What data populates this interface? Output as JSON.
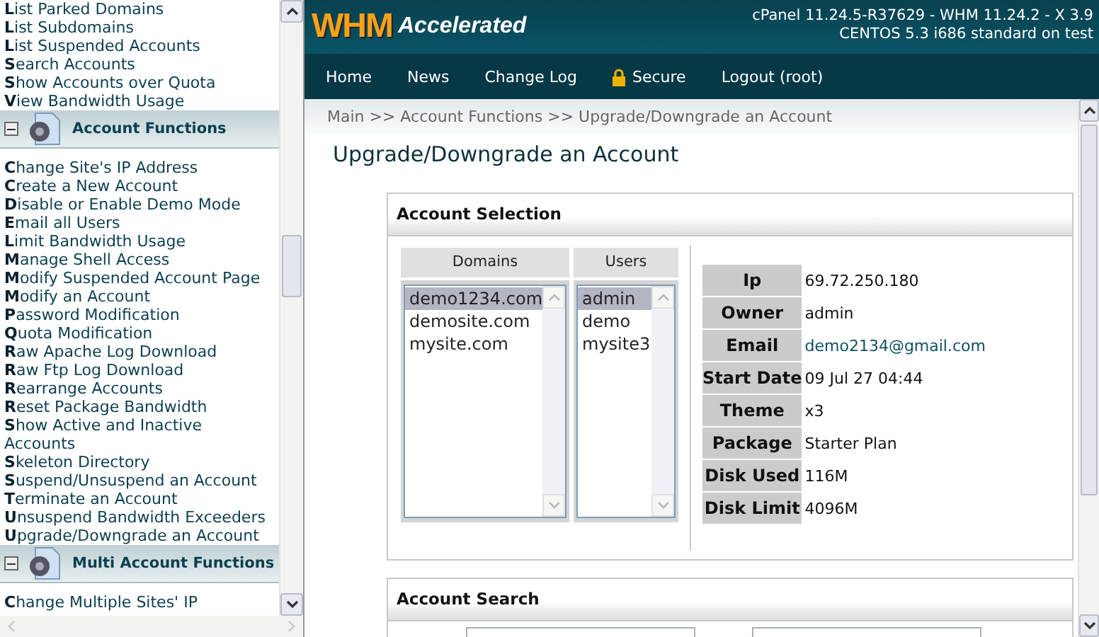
{
  "sidebar": {
    "top_links": [
      "**L**ist Parked Domains",
      "**L**ist Subdomains",
      "**L**ist Suspended Accounts",
      "**S**earch Accounts",
      "**S**how Accounts over Quota",
      "**V**iew Bandwidth Usage"
    ],
    "sections": [
      {
        "title": "Account Functions",
        "expanded": true,
        "links": [
          "**C**hange Site's IP Address",
          "**C**reate a New Account",
          "**D**isable or Enable Demo Mode",
          "**E**mail all Users",
          "**L**imit Bandwidth Usage",
          "**M**anage Shell Access",
          "**M**odify Suspended Account Page",
          "**M**odify an Account",
          "**P**assword Modification",
          "**Q**uota Modification",
          "**R**aw Apache Log Download",
          "**R**aw Ftp Log Download",
          "**R**earrange Accounts",
          "**R**eset Package Bandwidth",
          "**S**how Active and Inactive Accounts",
          "**S**keleton Directory",
          "**S**uspend/Unsuspend an Account",
          "**T**erminate an Account",
          "**U**nsuspend Bandwidth Exceeders",
          "**U**pgrade/Downgrade an Account"
        ]
      },
      {
        "title": "Multi Account Functions",
        "expanded": true,
        "links": [
          "**C**hange Multiple Sites' IP"
        ]
      }
    ]
  },
  "header": {
    "logo": {
      "mark": "WHM",
      "text": "Accelerated"
    },
    "info": [
      "cPanel 11.24.5-R37629 - WHM 11.24.2 - X 3.9",
      "CENTOS 5.3 i686 standard on test"
    ]
  },
  "nav": [
    {
      "label": "Home",
      "kind": "plain"
    },
    {
      "label": "News",
      "kind": "plain"
    },
    {
      "label": "Change Log",
      "kind": "plain"
    },
    {
      "label": "Secure",
      "kind": "locked"
    },
    {
      "label": "Logout (root)",
      "kind": "plain"
    }
  ],
  "breadcrumb": "Main >> Account Functions >> Upgrade/Downgrade an Account",
  "page_title": "Upgrade/Downgrade an Account",
  "account_selection": {
    "title": "Account Selection",
    "domains": {
      "heading": "Domains",
      "items": [
        {
          "label": "demo1234.com",
          "selected": true
        },
        {
          "label": "demosite.com",
          "selected": false
        },
        {
          "label": "mysite.com",
          "selected": false
        }
      ]
    },
    "users": {
      "heading": "Users",
      "items": [
        {
          "label": "admin",
          "selected": true
        },
        {
          "label": "demo",
          "selected": false
        },
        {
          "label": "mysite3",
          "selected": false
        }
      ]
    },
    "details": [
      {
        "label": "Ip",
        "value": "69.72.250.180",
        "kind": "text"
      },
      {
        "label": "Owner",
        "value": "admin",
        "kind": "text"
      },
      {
        "label": "Email",
        "value": "demo2134@gmail.com",
        "kind": "link"
      },
      {
        "label": "Start Date",
        "value": "09 Jul 27 04:44",
        "kind": "text"
      },
      {
        "label": "Theme",
        "value": "x3",
        "kind": "text"
      },
      {
        "label": "Package",
        "value": "Starter Plan",
        "kind": "text"
      },
      {
        "label": "Disk Used",
        "value": "116M",
        "kind": "text"
      },
      {
        "label": "Disk Limit",
        "value": "4096M",
        "kind": "text"
      }
    ]
  },
  "account_search": {
    "title": "Account Search"
  }
}
